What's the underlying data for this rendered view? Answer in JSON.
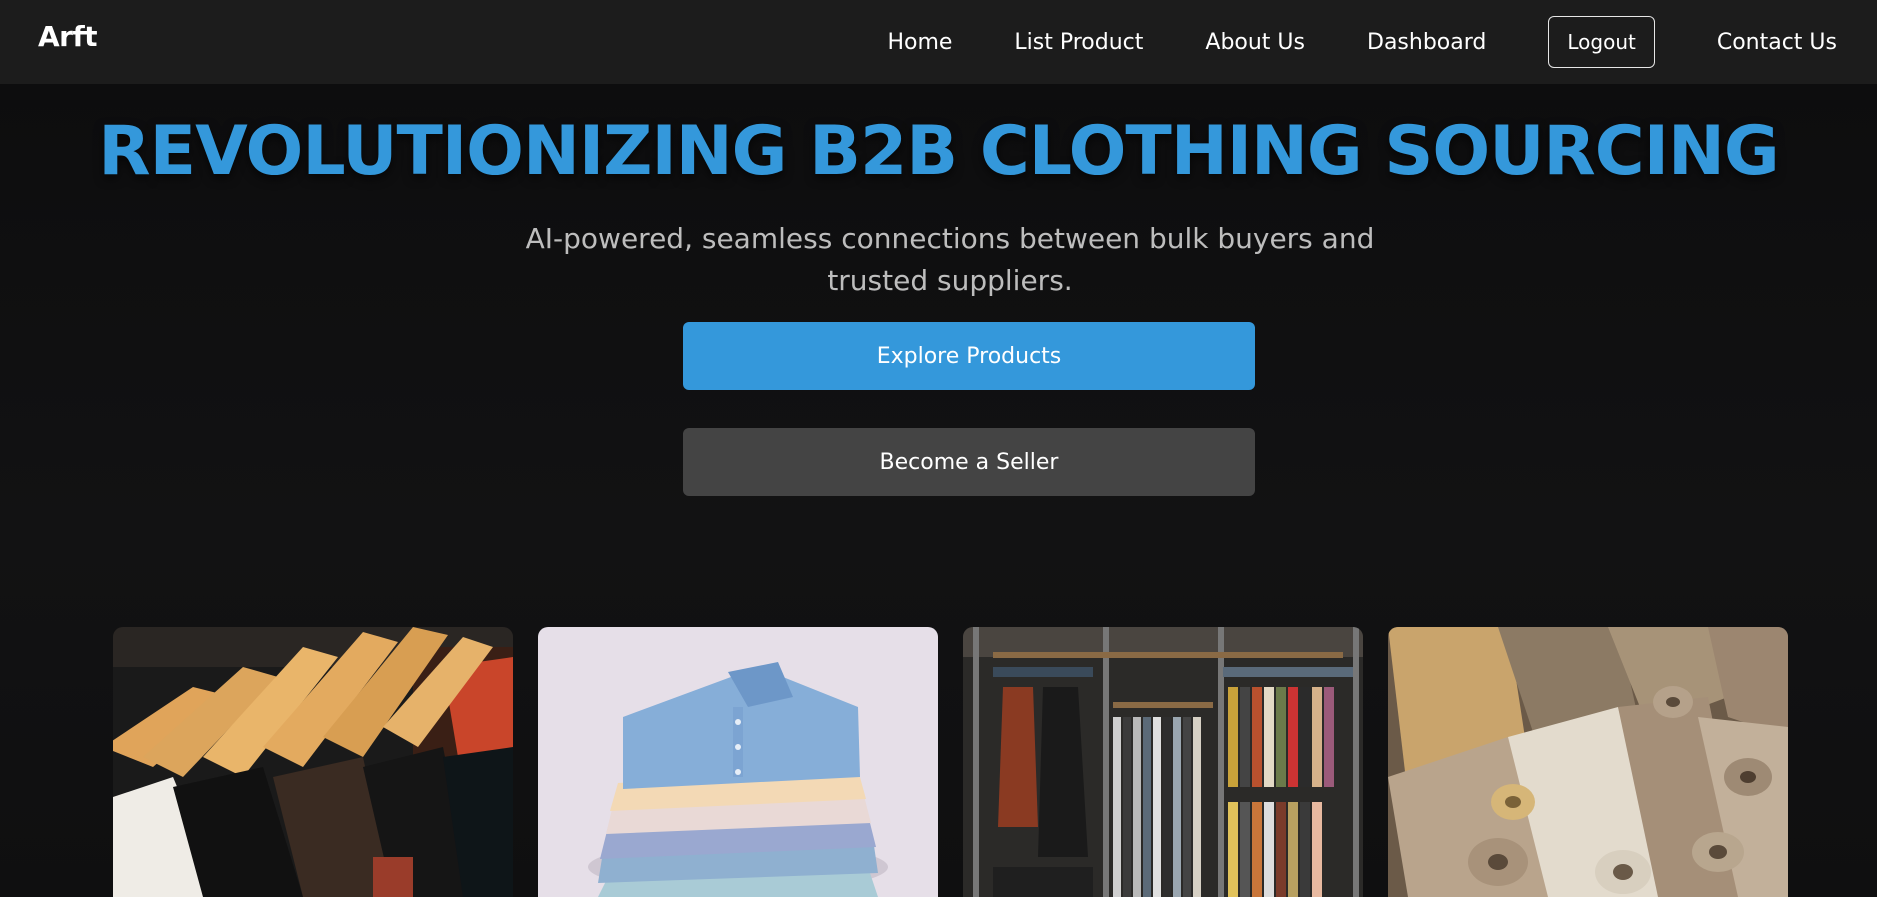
{
  "brand": {
    "logo": "Arft"
  },
  "nav": {
    "home": "Home",
    "list_product": "List Product",
    "about_us": "About Us",
    "dashboard": "Dashboard",
    "logout": "Logout",
    "contact_us": "Contact Us"
  },
  "hero": {
    "title": "REVOLUTIONIZING B2B CLOTHING SOURCING",
    "subtitle": "AI-powered, seamless connections between bulk buyers and trusted suppliers.",
    "explore_button": "Explore Products",
    "seller_button": "Become a Seller"
  },
  "gallery": {
    "images": [
      {
        "icon": "clothes-on-hangers-photo"
      },
      {
        "icon": "folded-shirts-stack-photo"
      },
      {
        "icon": "clothing-store-racks-photo"
      },
      {
        "icon": "fabric-rolls-photo"
      }
    ]
  },
  "colors": {
    "accent": "#3498db",
    "navbar_bg": "#1c1c1c",
    "page_bg": "#0f0f10",
    "secondary_button": "#444444"
  }
}
